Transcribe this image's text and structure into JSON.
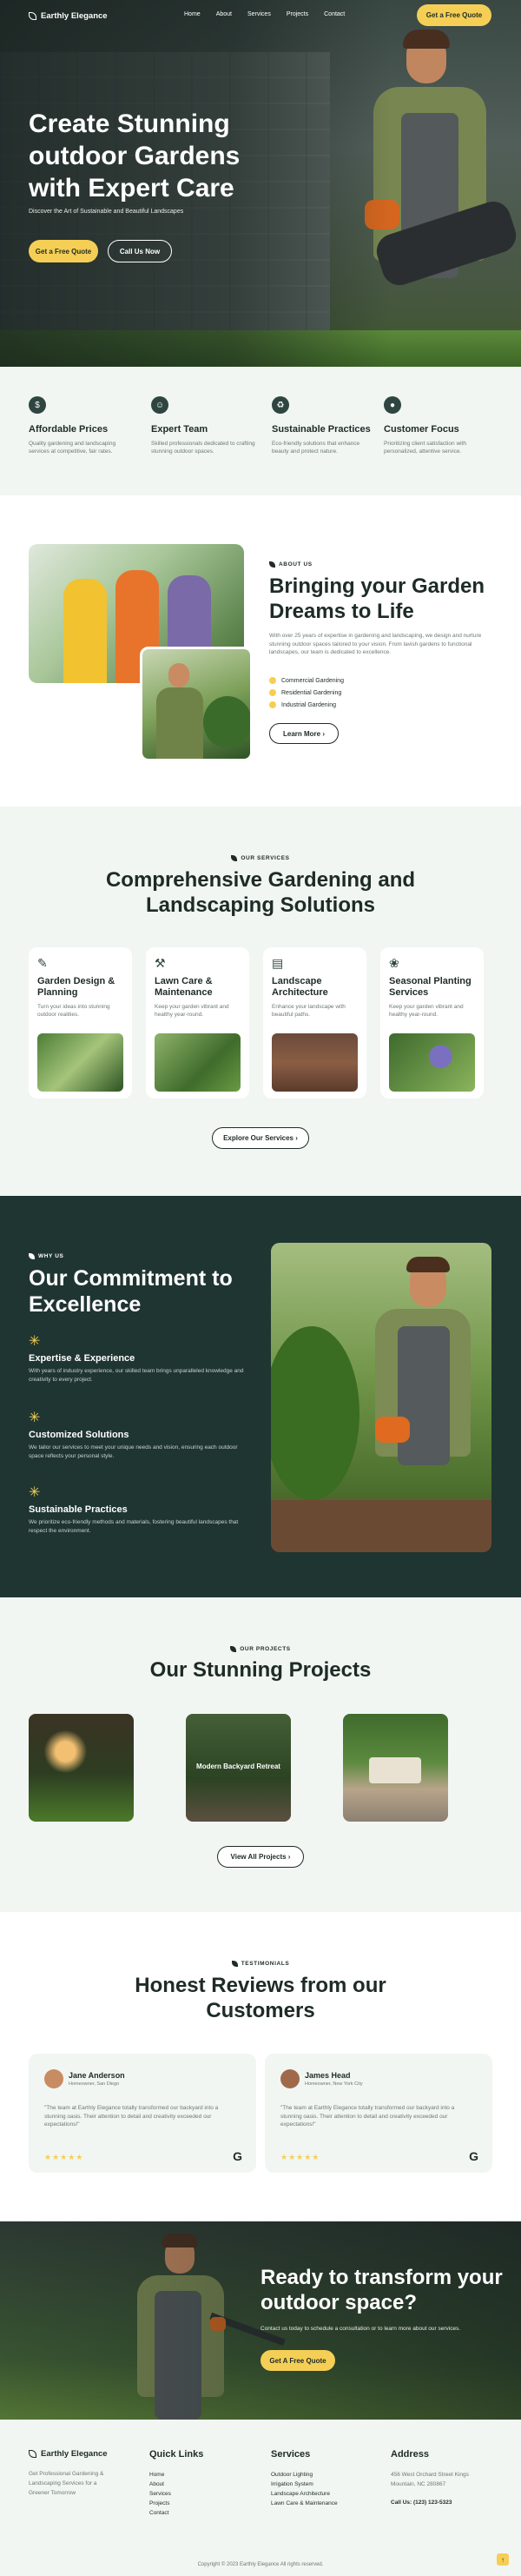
{
  "brand": {
    "name": "Earthly Elegance",
    "accent": "#f5cf55",
    "dark": "#1f3531"
  },
  "nav": {
    "links": [
      "Home",
      "About",
      "Services",
      "Projects",
      "Contact"
    ],
    "cta": "Get a Free Quote"
  },
  "hero": {
    "title": "Create Stunning outdoor Gardens with Expert Care",
    "subtitle": "Discover the Art of Sustainable and Beautiful Landscapes",
    "primary": "Get a Free Quote",
    "secondary": "Call Us Now"
  },
  "features": [
    {
      "icon": "dollar-icon",
      "title": "Affordable Prices",
      "desc": "Quality gardening and landscaping services at competitive, fair rates."
    },
    {
      "icon": "user-icon",
      "title": "Expert Team",
      "desc": "Skilled professionals dedicated to crafting stunning outdoor spaces."
    },
    {
      "icon": "recycle-icon",
      "title": "Sustainable Practices",
      "desc": "Eco-friendly solutions that enhance beauty and protect nature."
    },
    {
      "icon": "location-icon",
      "title": "Customer Focus",
      "desc": "Prioritizing client satisfaction with personalized, attentive service."
    }
  ],
  "about": {
    "tag": "ABOUT US",
    "title": "Bringing your Garden Dreams to Life",
    "text": "With over 25 years of expertise in gardening and landscaping, we design and nurture stunning outdoor spaces tailored to your vision. From lavish gardens to functional landscapes, our team is dedicated to excellence.",
    "checks": [
      "Commercial Gardening",
      "Residential Gardening",
      "Industrial Gardening"
    ],
    "button": "Learn More"
  },
  "services": {
    "tag": "OUR SERVICES",
    "title": "Comprehensive Gardening and Landscaping Solutions",
    "items": [
      {
        "icon": "garden-icon",
        "title": "Garden Design & Planning",
        "desc": "Turn your ideas into stunning outdoor realities."
      },
      {
        "icon": "lawn-icon",
        "title": "Lawn Care & Maintenance",
        "desc": "Keep your garden vibrant and healthy year-round."
      },
      {
        "icon": "landscape-icon",
        "title": "Landscape Architecture",
        "desc": "Enhance your landscape with beautiful paths."
      },
      {
        "icon": "planting-icon",
        "title": "Seasonal Planting Services",
        "desc": "Keep your garden vibrant and healthy year-round."
      }
    ],
    "button": "Explore Our Services"
  },
  "commit": {
    "tag": "WHY US",
    "title": "Our Commitment to Excellence",
    "items": [
      {
        "title": "Expertise & Experience",
        "desc": "With years of industry experience, our skilled team brings unparalleled knowledge and creativity to every project."
      },
      {
        "title": "Customized Solutions",
        "desc": "We tailor our services to meet your unique needs and vision, ensuring each outdoor space reflects your personal style."
      },
      {
        "title": "Sustainable Practices",
        "desc": "We prioritize eco-friendly methods and materials, fostering beautiful landscapes that respect the environment."
      }
    ]
  },
  "projects": {
    "tag": "OUR PROJECTS",
    "title": "Our Stunning Projects",
    "items": [
      "",
      "Modern Backyard Retreat",
      ""
    ],
    "button": "View All Projects"
  },
  "testimonials": {
    "tag": "TESTIMONIALS",
    "title": "Honest Reviews from our Customers",
    "items": [
      {
        "name": "Jane Anderson",
        "role": "Homeowner, San Diego",
        "quote": "\"The team at Earthly Elegance totally transformed our backyard into a stunning oasis. Their attention to detail and creativity exceeded our expectations!\"",
        "stars": "★★★★★"
      },
      {
        "name": "James Head",
        "role": "Homeowner, New York City",
        "quote": "\"The team at Earthly Elegance totally transformed our backyard into a stunning oasis. Their attention to detail and creativity exceeded our expectations!\"",
        "stars": "★★★★★"
      }
    ]
  },
  "cta": {
    "title": "Ready to transform your outdoor space?",
    "text": "Contact us today to schedule a consultation or to learn more about our services.",
    "button": "Get A Free Quote"
  },
  "footer": {
    "tagline": "Get Professional Gardening & Landscaping Services for a Greener Tomorrow",
    "quick_title": "Quick Links",
    "quick": [
      "Home",
      "About",
      "Services",
      "Projects",
      "Contact"
    ],
    "services_title": "Services",
    "services": [
      "Outdoor Lighting",
      "Irrigation System",
      "Landscape Architecture",
      "Lawn Care & Maintenance"
    ],
    "address_title": "Address",
    "address": "456 West Orchard Street Kings Mountain, NC 280867",
    "phone": "Call Us: (123) 123-5323",
    "copyright": "Copyright © 2023 Earthly Elegance All rights reserved."
  }
}
